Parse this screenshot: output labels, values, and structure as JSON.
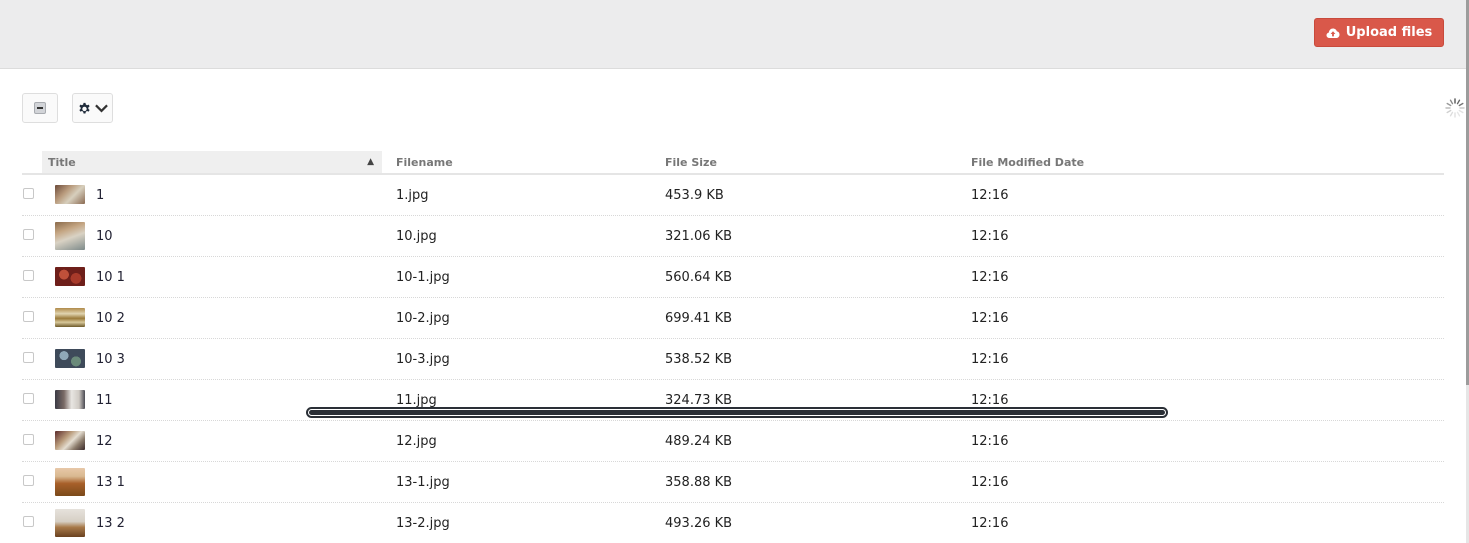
{
  "header": {
    "upload_label": "Upload files",
    "upload_icon": "cloud-upload-icon",
    "accent_color": "#d9584a"
  },
  "toolbar": {
    "select_icon": "select-all-toggle-icon",
    "settings_icon": "gear-icon",
    "status_icon": "loading-spinner-icon"
  },
  "table": {
    "columns": [
      {
        "label": "Title",
        "sort": "ascending"
      },
      {
        "label": "Filename"
      },
      {
        "label": "File Size"
      },
      {
        "label": "File Modified Date"
      }
    ],
    "rows": [
      {
        "title": "1",
        "filename": "1.jpg",
        "size": "453.9 KB",
        "modified": "12:16"
      },
      {
        "title": "10",
        "filename": "10.jpg",
        "size": "321.06 KB",
        "modified": "12:16"
      },
      {
        "title": "10 1",
        "filename": "10-1.jpg",
        "size": "560.64 KB",
        "modified": "12:16"
      },
      {
        "title": "10 2",
        "filename": "10-2.jpg",
        "size": "699.41 KB",
        "modified": "12:16"
      },
      {
        "title": "10 3",
        "filename": "10-3.jpg",
        "size": "538.52 KB",
        "modified": "12:16"
      },
      {
        "title": "11",
        "filename": "11.jpg",
        "size": "324.73 KB",
        "modified": "12:16"
      },
      {
        "title": "12",
        "filename": "12.jpg",
        "size": "489.24 KB",
        "modified": "12:16"
      },
      {
        "title": "13 1",
        "filename": "13-1.jpg",
        "size": "358.88 KB",
        "modified": "12:16"
      },
      {
        "title": "13 2",
        "filename": "13-2.jpg",
        "size": "493.26 KB",
        "modified": "12:16"
      }
    ]
  }
}
